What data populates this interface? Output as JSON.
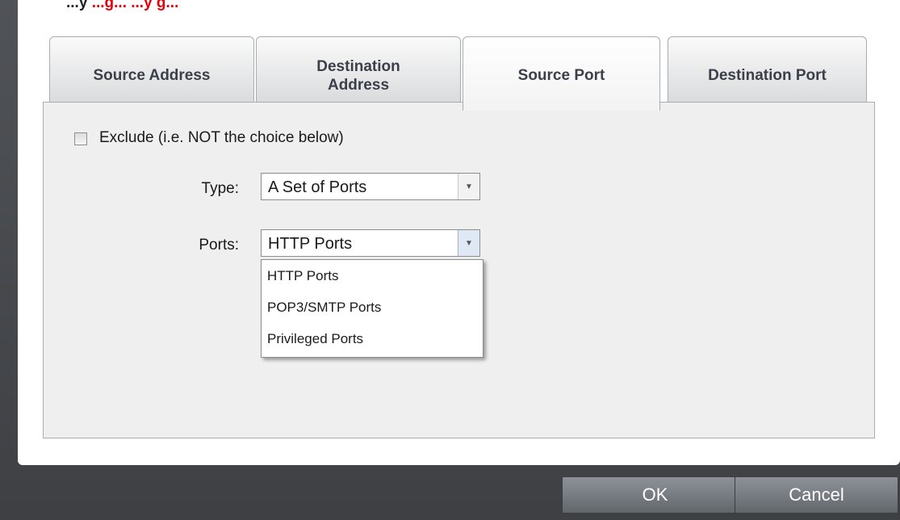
{
  "banner": {
    "lead_text": "...y",
    "highlight_text": "...g... ...y g..."
  },
  "tabs": [
    {
      "label": "Source Address"
    },
    {
      "label": "Destination Address"
    },
    {
      "label": "Source Port"
    },
    {
      "label": "Destination Port"
    }
  ],
  "active_tab": "Source Port",
  "exclude": {
    "label": "Exclude (i.e. NOT the choice below)",
    "checked": false
  },
  "type_field": {
    "label": "Type:",
    "value": "A Set of Ports"
  },
  "ports_field": {
    "label": "Ports:",
    "value": "HTTP Ports",
    "options": [
      "HTTP Ports",
      "POP3/SMTP Ports",
      "Privileged Ports"
    ]
  },
  "buttons": {
    "ok": "OK",
    "cancel": "Cancel"
  },
  "colors": {
    "banner_red": "#e8000a",
    "frame_dark": "#4a4c50"
  },
  "icons": {
    "dropdown_arrow": "chevron-down-icon"
  }
}
